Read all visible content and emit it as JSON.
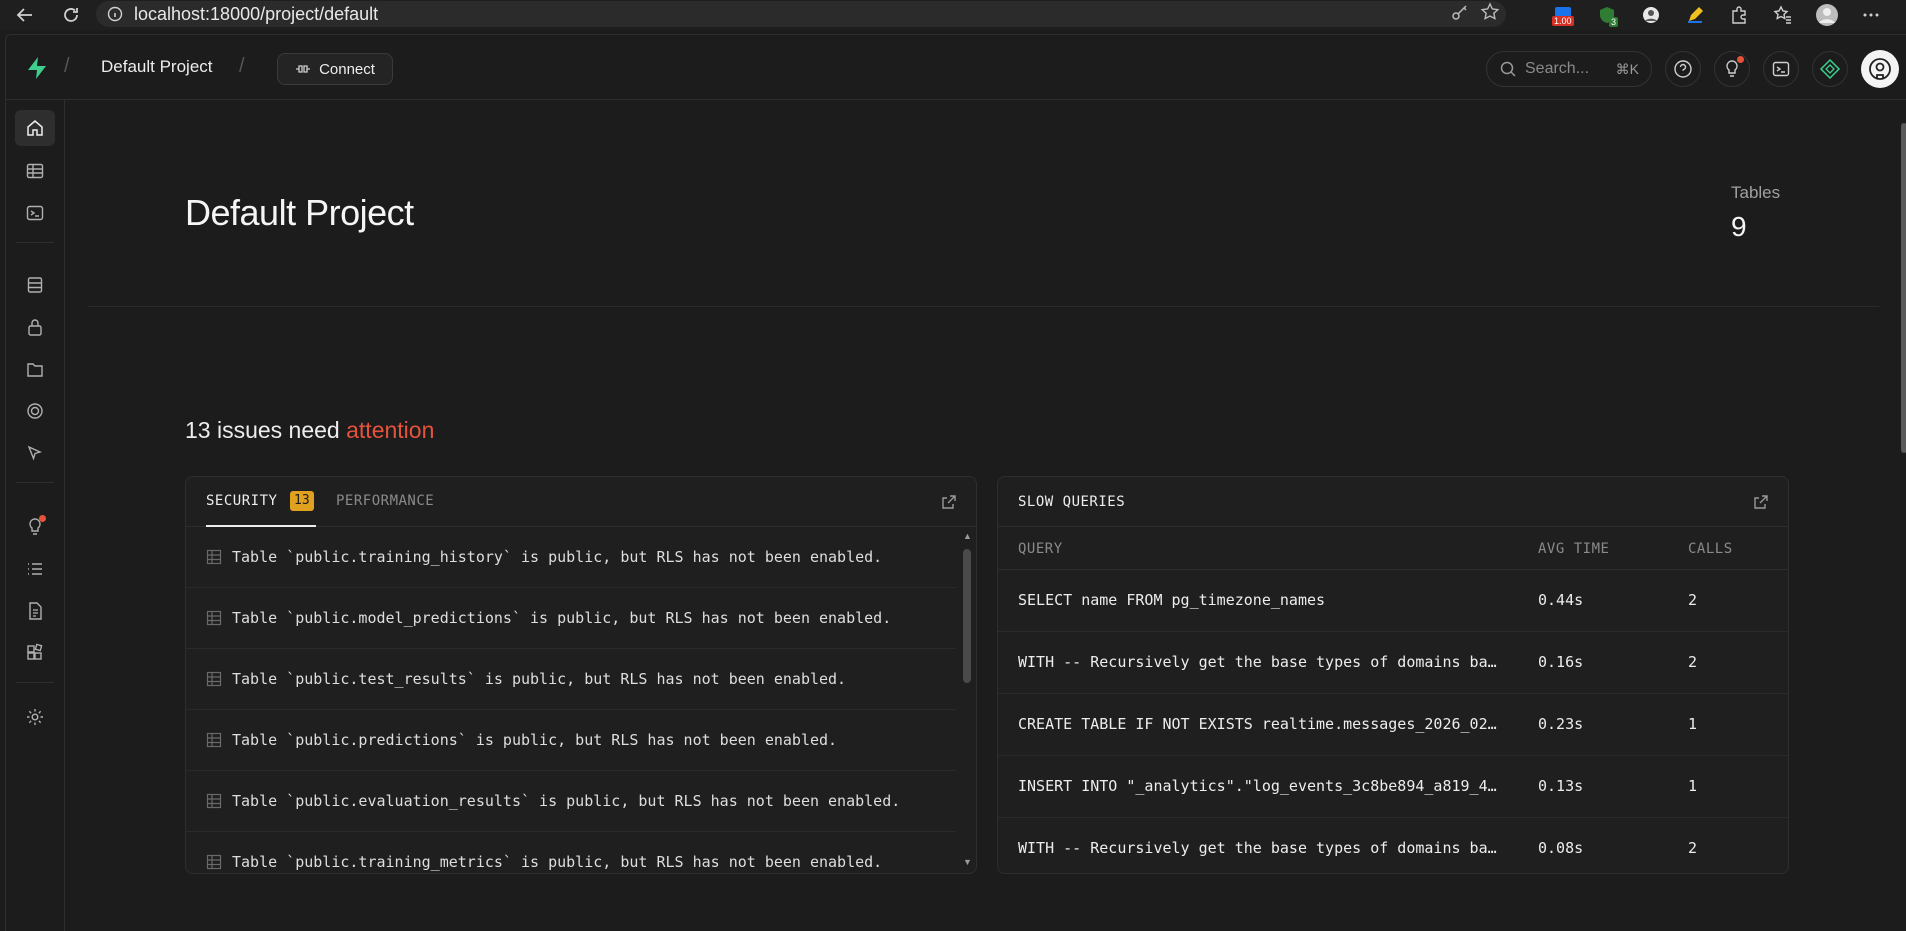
{
  "browser": {
    "url": "localhost:18000/project/default",
    "ext_badge_price": "1.00",
    "ext_badge_count": "3"
  },
  "topbar": {
    "project_name": "Default Project",
    "connect_label": "Connect",
    "search_placeholder": "Search...",
    "search_shortcut": "⌘K"
  },
  "page": {
    "title": "Default Project",
    "tables_label": "Tables",
    "tables_value": "9"
  },
  "issues": {
    "title_prefix": "13 issues need ",
    "title_accent": "attention",
    "accent_color": "#e5533b",
    "tabs": {
      "security": "SECURITY",
      "security_count": "13",
      "performance": "PERFORMANCE"
    },
    "items": [
      "Table `public.training_history` is public, but RLS has not been enabled.",
      "Table `public.model_predictions` is public, but RLS has not been enabled.",
      "Table `public.test_results` is public, but RLS has not been enabled.",
      "Table `public.predictions` is public, but RLS has not been enabled.",
      "Table `public.evaluation_results` is public, but RLS has not been enabled.",
      "Table `public.training_metrics` is public, but RLS has not been enabled."
    ]
  },
  "slow_queries": {
    "title": "SLOW QUERIES",
    "columns": {
      "query": "QUERY",
      "avg_time": "AVG TIME",
      "calls": "CALLS"
    },
    "rows": [
      {
        "query": "SELECT name FROM pg_timezone_names",
        "avg_time": "0.44s",
        "calls": "2"
      },
      {
        "query": "WITH -- Recursively get the base types of domains ba…",
        "avg_time": "0.16s",
        "calls": "2"
      },
      {
        "query": "CREATE TABLE IF NOT EXISTS realtime.messages_2026_02…",
        "avg_time": "0.23s",
        "calls": "1"
      },
      {
        "query": "INSERT INTO \"_analytics\".\"log_events_3c8be894_a819_4…",
        "avg_time": "0.13s",
        "calls": "1"
      },
      {
        "query": "WITH -- Recursively get the base types of domains ba…",
        "avg_time": "0.08s",
        "calls": "2"
      }
    ]
  },
  "colors": {
    "brand_green": "#3ecf8e",
    "warning_badge": "#e0a020",
    "background": "#1c1c1c"
  }
}
